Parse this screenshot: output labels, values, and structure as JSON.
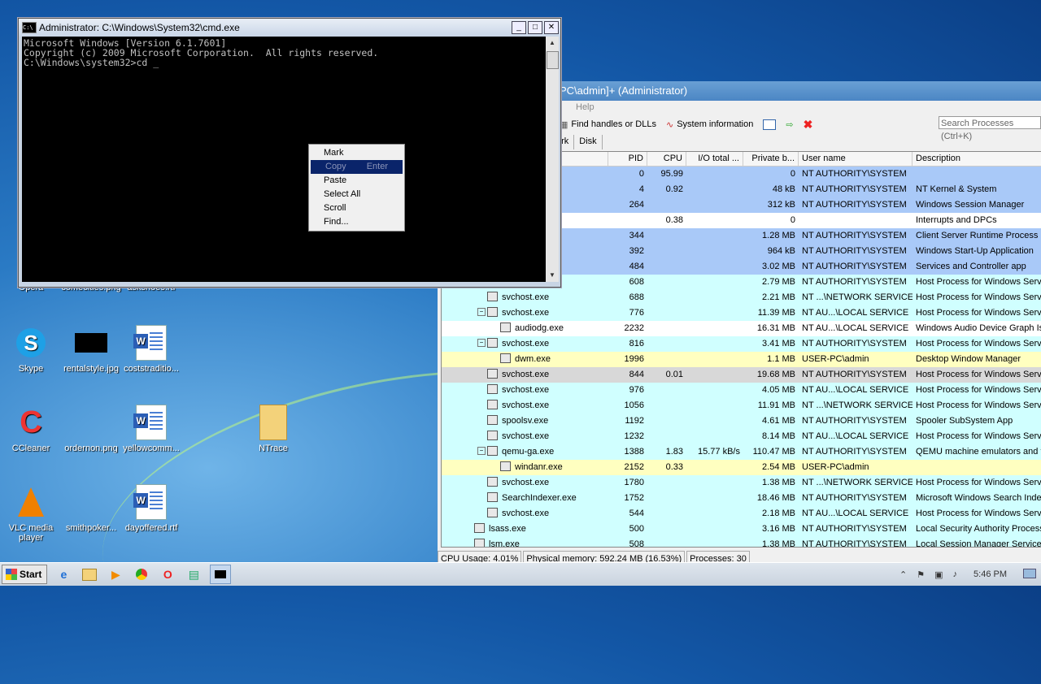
{
  "desktop": {
    "icons": [
      {
        "label": "Opera"
      },
      {
        "label": "comecities.png"
      },
      {
        "label": "askshoes.rtf"
      },
      {
        "label": "Skype"
      },
      {
        "label": "rentalstyle.jpg"
      },
      {
        "label": "coststraditio..."
      },
      {
        "label": "CCleaner"
      },
      {
        "label": "ordernon.png"
      },
      {
        "label": "yellowcomm..."
      },
      {
        "label": "NTrace"
      },
      {
        "label": "VLC media player"
      },
      {
        "label": "smithpoker..."
      },
      {
        "label": "dayoffered.rtf"
      }
    ]
  },
  "cmd": {
    "title": "Administrator: C:\\Windows\\System32\\cmd.exe",
    "lines": [
      "Microsoft Windows [Version 6.1.7601]",
      "Copyright (c) 2009 Microsoft Corporation.  All rights reserved.",
      "",
      "C:\\Windows\\system32>cd _"
    ],
    "context_menu": [
      {
        "label": "Mark",
        "accel": ""
      },
      {
        "label": "Copy",
        "accel": "Enter"
      },
      {
        "label": "Paste",
        "accel": ""
      },
      {
        "label": "Select All",
        "accel": ""
      },
      {
        "label": "Scroll",
        "accel": ""
      },
      {
        "label": "Find...",
        "accel": ""
      }
    ]
  },
  "procexp": {
    "title": "PC\\admin]+ (Administrator)",
    "menu_help": "Help",
    "toolbar": {
      "handles": "Find handles or DLLs",
      "sysinfo": "System information"
    },
    "search_placeholder": "Search Processes (Ctrl+K)",
    "tabs": [
      "ork",
      "Disk"
    ],
    "columns": [
      "PID",
      "CPU",
      "I/O total ...",
      "Private b...",
      "User name",
      "Description"
    ],
    "rows": [
      {
        "name": "",
        "pid": "0",
        "cpu": "95.99",
        "io": "",
        "priv": "0",
        "user": "NT AUTHORITY\\SYSTEM",
        "desc": "",
        "bg": "bg-blue",
        "indent": 0
      },
      {
        "name": "",
        "pid": "4",
        "cpu": "0.92",
        "io": "",
        "priv": "48 kB",
        "user": "NT AUTHORITY\\SYSTEM",
        "desc": "NT Kernel & System",
        "bg": "bg-blue",
        "indent": 0
      },
      {
        "name": "",
        "pid": "264",
        "cpu": "",
        "io": "",
        "priv": "312 kB",
        "user": "NT AUTHORITY\\SYSTEM",
        "desc": "Windows Session Manager",
        "bg": "bg-blue",
        "indent": 0
      },
      {
        "name": "",
        "pid": "",
        "cpu": "0.38",
        "io": "",
        "priv": "0",
        "user": "",
        "desc": "Interrupts and DPCs",
        "bg": "bg-white",
        "indent": 0
      },
      {
        "name": "",
        "pid": "344",
        "cpu": "",
        "io": "",
        "priv": "1.28 MB",
        "user": "NT AUTHORITY\\SYSTEM",
        "desc": "Client Server Runtime Process",
        "bg": "bg-blue",
        "indent": 0
      },
      {
        "name": "",
        "pid": "392",
        "cpu": "",
        "io": "",
        "priv": "964 kB",
        "user": "NT AUTHORITY\\SYSTEM",
        "desc": "Windows Start-Up Application",
        "bg": "bg-blue",
        "indent": 0
      },
      {
        "name": "",
        "pid": "484",
        "cpu": "",
        "io": "",
        "priv": "3.02 MB",
        "user": "NT AUTHORITY\\SYSTEM",
        "desc": "Services and Controller app",
        "bg": "bg-blue",
        "indent": 0
      },
      {
        "name": "",
        "pid": "608",
        "cpu": "",
        "io": "",
        "priv": "2.79 MB",
        "user": "NT AUTHORITY\\SYSTEM",
        "desc": "Host Process for Windows Servi",
        "bg": "bg-cyan",
        "indent": 0
      },
      {
        "name": "svchost.exe",
        "pid": "688",
        "cpu": "",
        "io": "",
        "priv": "2.21 MB",
        "user": "NT ...\\NETWORK SERVICE",
        "desc": "Host Process for Windows Servi",
        "bg": "bg-cyan",
        "indent": 1
      },
      {
        "name": "svchost.exe",
        "pid": "776",
        "cpu": "",
        "io": "",
        "priv": "11.39 MB",
        "user": "NT AU...\\LOCAL SERVICE",
        "desc": "Host Process for Windows Servi",
        "bg": "bg-cyan",
        "indent": 1,
        "tree": true
      },
      {
        "name": "audiodg.exe",
        "pid": "2232",
        "cpu": "",
        "io": "",
        "priv": "16.31 MB",
        "user": "NT AU...\\LOCAL SERVICE",
        "desc": "Windows Audio Device Graph Is",
        "bg": "bg-white",
        "indent": 2
      },
      {
        "name": "svchost.exe",
        "pid": "816",
        "cpu": "",
        "io": "",
        "priv": "3.41 MB",
        "user": "NT AUTHORITY\\SYSTEM",
        "desc": "Host Process for Windows Servi",
        "bg": "bg-cyan",
        "indent": 1,
        "tree": true
      },
      {
        "name": "dwm.exe",
        "pid": "1996",
        "cpu": "",
        "io": "",
        "priv": "1.1 MB",
        "user": "USER-PC\\admin",
        "desc": "Desktop Window Manager",
        "bg": "bg-yel",
        "indent": 2
      },
      {
        "name": "svchost.exe",
        "pid": "844",
        "cpu": "0.01",
        "io": "",
        "priv": "19.68 MB",
        "user": "NT AUTHORITY\\SYSTEM",
        "desc": "Host Process for Windows Servi",
        "bg": "bg-gray",
        "indent": 1
      },
      {
        "name": "svchost.exe",
        "pid": "976",
        "cpu": "",
        "io": "",
        "priv": "4.05 MB",
        "user": "NT AU...\\LOCAL SERVICE",
        "desc": "Host Process for Windows Servi",
        "bg": "bg-cyan",
        "indent": 1
      },
      {
        "name": "svchost.exe",
        "pid": "1056",
        "cpu": "",
        "io": "",
        "priv": "11.91 MB",
        "user": "NT ...\\NETWORK SERVICE",
        "desc": "Host Process for Windows Servi",
        "bg": "bg-cyan",
        "indent": 1
      },
      {
        "name": "spoolsv.exe",
        "pid": "1192",
        "cpu": "",
        "io": "",
        "priv": "4.61 MB",
        "user": "NT AUTHORITY\\SYSTEM",
        "desc": "Spooler SubSystem App",
        "bg": "bg-cyan",
        "indent": 1
      },
      {
        "name": "svchost.exe",
        "pid": "1232",
        "cpu": "",
        "io": "",
        "priv": "8.14 MB",
        "user": "NT AU...\\LOCAL SERVICE",
        "desc": "Host Process for Windows Servi",
        "bg": "bg-cyan",
        "indent": 1
      },
      {
        "name": "qemu-ga.exe",
        "pid": "1388",
        "cpu": "1.83",
        "io": "15.77 kB/s",
        "priv": "110.47 MB",
        "user": "NT AUTHORITY\\SYSTEM",
        "desc": "QEMU machine emulators and to",
        "bg": "bg-cyan",
        "indent": 1,
        "tree": true
      },
      {
        "name": "windanr.exe",
        "pid": "2152",
        "cpu": "0.33",
        "io": "",
        "priv": "2.54 MB",
        "user": "USER-PC\\admin",
        "desc": "",
        "bg": "bg-yel",
        "indent": 2
      },
      {
        "name": "svchost.exe",
        "pid": "1780",
        "cpu": "",
        "io": "",
        "priv": "1.38 MB",
        "user": "NT ...\\NETWORK SERVICE",
        "desc": "Host Process for Windows Servi",
        "bg": "bg-cyan",
        "indent": 1
      },
      {
        "name": "SearchIndexer.exe",
        "pid": "1752",
        "cpu": "",
        "io": "",
        "priv": "18.46 MB",
        "user": "NT AUTHORITY\\SYSTEM",
        "desc": "Microsoft Windows Search Index",
        "bg": "bg-cyan",
        "indent": 1
      },
      {
        "name": "svchost.exe",
        "pid": "544",
        "cpu": "",
        "io": "",
        "priv": "2.18 MB",
        "user": "NT AU...\\LOCAL SERVICE",
        "desc": "Host Process for Windows Servi",
        "bg": "bg-cyan",
        "indent": 1
      },
      {
        "name": "lsass.exe",
        "pid": "500",
        "cpu": "",
        "io": "",
        "priv": "3.16 MB",
        "user": "NT AUTHORITY\\SYSTEM",
        "desc": "Local Security Authority Process",
        "bg": "bg-cyan",
        "indent": 0
      },
      {
        "name": "lsm.exe",
        "pid": "508",
        "cpu": "",
        "io": "",
        "priv": "1.38 MB",
        "user": "NT AUTHORITY\\SYSTEM",
        "desc": "Local Session Manager Service",
        "bg": "bg-cyan",
        "indent": 0
      }
    ],
    "status": {
      "cpu": "CPU Usage: 4.01%",
      "mem": "Physical memory: 592.24 MB (16.53%)",
      "procs": "Processes: 30"
    }
  },
  "taskbar": {
    "start": "Start",
    "clock": "5:46 PM"
  }
}
